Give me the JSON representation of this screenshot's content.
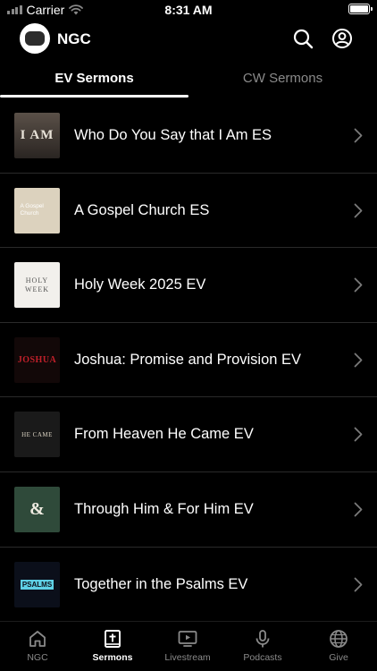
{
  "status_bar": {
    "carrier": "Carrier",
    "time": "8:31 AM"
  },
  "header": {
    "title": "NGC"
  },
  "tabs": [
    {
      "label": "EV Sermons",
      "active": true
    },
    {
      "label": "CW Sermons",
      "active": false
    }
  ],
  "sermons": [
    {
      "title": "Who Do You Say that I Am ES",
      "thumb_text": "I AM",
      "thumb_bg": "#3a3530"
    },
    {
      "title": "A Gospel Church ES",
      "thumb_text": "A Gospel Church",
      "thumb_bg": "#e0d6c4"
    },
    {
      "title": "Holy Week 2025 EV",
      "thumb_text": "HOLY WEEK",
      "thumb_bg": "#f2f0ec"
    },
    {
      "title": "Joshua: Promise and Provision EV",
      "thumb_text": "JOSHUA",
      "thumb_bg": "#120808"
    },
    {
      "title": "From Heaven He Came EV",
      "thumb_text": "HE CAME",
      "thumb_bg": "#1a1a1a"
    },
    {
      "title": "Through Him & For Him EV",
      "thumb_text": "&",
      "thumb_bg": "#2f4a3a"
    },
    {
      "title": "Together in the Psalms EV",
      "thumb_text": "PSALMS",
      "thumb_bg": "#0b0f1a"
    }
  ],
  "tab_bar": [
    {
      "label": "NGC",
      "icon": "home-icon",
      "active": false
    },
    {
      "label": "Sermons",
      "icon": "bible-icon",
      "active": true
    },
    {
      "label": "Livestream",
      "icon": "tv-play-icon",
      "active": false
    },
    {
      "label": "Podcasts",
      "icon": "microphone-icon",
      "active": false
    },
    {
      "label": "Give",
      "icon": "globe-icon",
      "active": false
    }
  ],
  "colors": {
    "background": "#000000",
    "text": "#ffffff",
    "muted": "#8a8a8a",
    "divider": "#2a2a2a"
  }
}
